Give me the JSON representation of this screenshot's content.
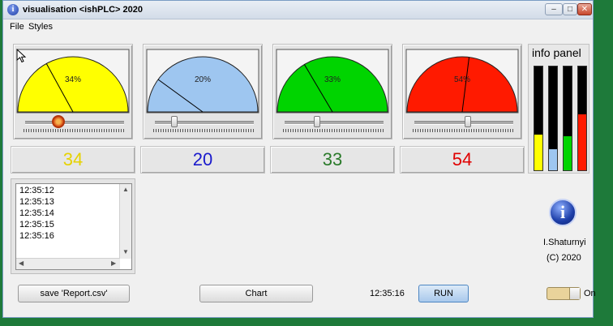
{
  "window": {
    "title": "visualisation <ishPLC> 2020",
    "icon": "info-icon",
    "controls": [
      "minimize",
      "maximize",
      "close"
    ]
  },
  "menu": [
    "File",
    "Styles"
  ],
  "gauges": [
    {
      "label": "34%",
      "value": 34,
      "value_text": "34",
      "fill": "#ffff00",
      "text_color": "#e6d200",
      "slider_fraction": 0.34
    },
    {
      "label": "20%",
      "value": 20,
      "value_text": "20",
      "fill": "#9ec6f0",
      "text_color": "#1a1acc",
      "slider_fraction": 0.2
    },
    {
      "label": "33%",
      "value": 33,
      "value_text": "33",
      "fill": "#00d400",
      "text_color": "#2a7a2a",
      "slider_fraction": 0.33
    },
    {
      "label": "54%",
      "value": 54,
      "value_text": "54",
      "fill": "#ff1a00",
      "text_color": "#e00000",
      "slider_fraction": 0.54
    }
  ],
  "info_panel": {
    "title": "info panel",
    "bars": [
      {
        "value": 34,
        "color": "#ffff00"
      },
      {
        "value": 20,
        "color": "#9ec6f0"
      },
      {
        "value": 33,
        "color": "#00d400"
      },
      {
        "value": 54,
        "color": "#ff1a00"
      }
    ]
  },
  "log": [
    "12:35:12",
    "12:35:13",
    "12:35:14",
    "12:35:15",
    "12:35:16"
  ],
  "about": {
    "author": "I.Shaturnyi",
    "copyright": "(C) 2020"
  },
  "footer": {
    "save_label": "save 'Report.csv'",
    "chart_label": "Chart",
    "time": "12:35:16",
    "run_label": "RUN",
    "toggle_label": "On",
    "toggle_on": true
  }
}
